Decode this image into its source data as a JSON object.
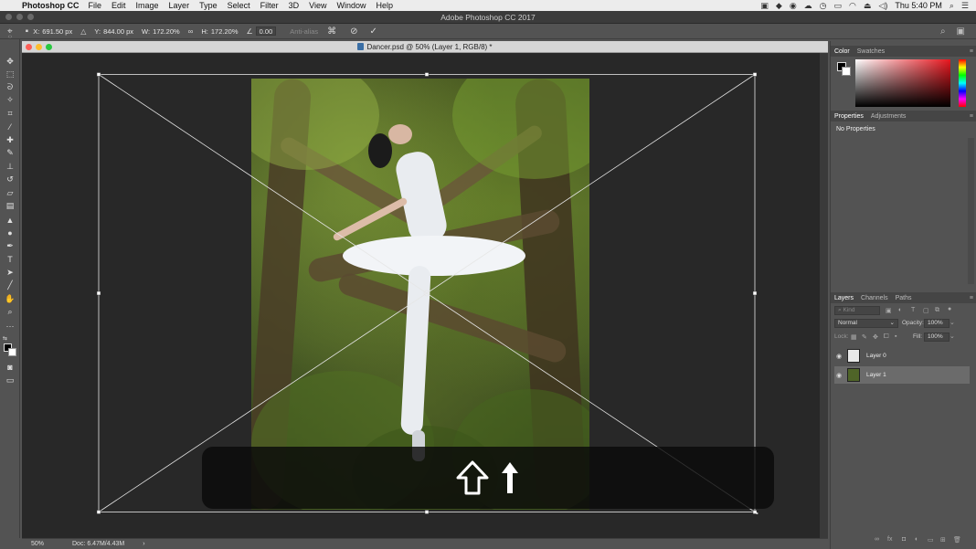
{
  "menubar": {
    "app_name": "Photoshop CC",
    "menus": [
      "File",
      "Edit",
      "Image",
      "Layer",
      "Type",
      "Select",
      "Filter",
      "3D",
      "View",
      "Window",
      "Help"
    ],
    "clock": "Thu 5:40 PM"
  },
  "window": {
    "title": "Adobe Photoshop CC 2017"
  },
  "options": {
    "x_label": "X:",
    "x_value": "691.50 px",
    "y_label": "Y:",
    "y_value": "844.00 px",
    "w_label": "W:",
    "w_value": "172.20%",
    "h_label": "H:",
    "h_value": "172.20%",
    "angle_value": "0.00",
    "antialias_label": "Anti-alias"
  },
  "document": {
    "tab_title": "Dancer.psd @ 50% (Layer 1, RGB/8) *"
  },
  "statusbar": {
    "zoom": "50%",
    "doc_size": "Doc: 6.47M/4.43M",
    "arrow": "›"
  },
  "panels": {
    "color_tabs": [
      "Color",
      "Swatches"
    ],
    "props_tabs": [
      "Properties",
      "Adjustments"
    ],
    "no_properties": "No Properties",
    "layers_tabs": [
      "Layers",
      "Channels",
      "Paths"
    ],
    "search_placeholder": "Kind",
    "blend_mode": "Normal",
    "opacity_label": "Opacity:",
    "opacity_value": "100%",
    "lock_label": "Lock:",
    "fill_label": "Fill:",
    "fill_value": "100%",
    "layers": [
      {
        "name": "Layer 0",
        "selected": false
      },
      {
        "name": "Layer 1",
        "selected": true
      }
    ]
  },
  "colors": {
    "ui_dark": "#535353",
    "canvas_bg": "#282828",
    "accent_red": "#e8161e"
  },
  "icons": {
    "keystroke_left": "shift-key-icon",
    "keystroke_right": "arrow-up-icon"
  }
}
